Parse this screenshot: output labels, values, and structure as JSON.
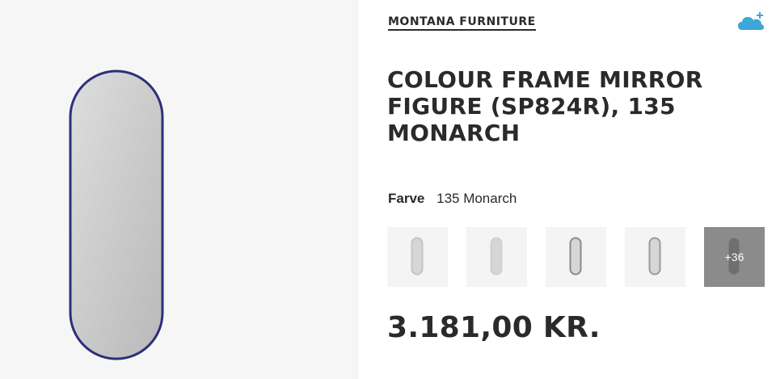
{
  "brand": "MONTANA FURNITURE",
  "product": {
    "title": "COLOUR FRAME MIRROR FIGURE (SP824R), 135 MONARCH",
    "color_label": "Farve",
    "color_value": "135 Monarch",
    "price": "3.181,00 KR.",
    "image_frame_color": "#2e2f7a"
  },
  "swatches": [
    {
      "name": "swatch-1",
      "frame_color": "#c4c4c4"
    },
    {
      "name": "swatch-2",
      "frame_color": "#d0d0d0"
    },
    {
      "name": "swatch-3",
      "frame_color": "#8a8a8a"
    },
    {
      "name": "swatch-4",
      "frame_color": "#9a9a9a"
    }
  ],
  "more_swatches_label": "+36",
  "icons": {
    "cloud": "cloud-plus-icon",
    "accent": "#3fa7d6"
  }
}
